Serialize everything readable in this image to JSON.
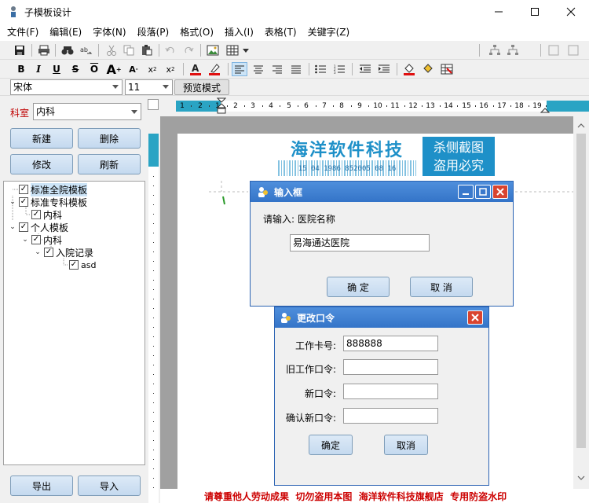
{
  "window": {
    "title": "子模板设计"
  },
  "menu": [
    "文件(F)",
    "编辑(E)",
    "字体(N)",
    "段落(P)",
    "格式(O)",
    "插入(I)",
    "表格(T)",
    "关键字(Z)"
  ],
  "format_bar": {
    "font": "宋体",
    "size": "11",
    "preview_button": "预览模式"
  },
  "left": {
    "department_label": "科室",
    "department_value": "内科",
    "new_button": "新建",
    "delete_button": "删除",
    "edit_button": "修改",
    "refresh_button": "刷新",
    "export_button": "导出",
    "import_button": "导入",
    "tree": [
      {
        "label": "标准全院模板",
        "toggle": "",
        "checked": true
      },
      {
        "label": "标准专科模板",
        "toggle": "v",
        "checked": true
      },
      {
        "label": "内科",
        "toggle": "",
        "checked": true
      },
      {
        "label": "个人模板",
        "toggle": "v",
        "checked": true
      },
      {
        "label": "内科",
        "toggle": "v",
        "checked": true
      },
      {
        "label": "入院记录",
        "toggle": "v",
        "checked": true
      },
      {
        "label": "asd",
        "toggle": "",
        "checked": true
      }
    ]
  },
  "ruler": {
    "labels": [
      "1",
      "2",
      "1",
      "2",
      "3",
      "4",
      "5",
      "6",
      "7",
      "8",
      "9",
      "10",
      "11",
      "12",
      "13",
      "14",
      "15",
      "16",
      "17",
      "18",
      "19"
    ]
  },
  "watermark": {
    "brand": "海洋软件科技",
    "digits": "15 04 1986 852005 08 16",
    "stamp_line1": "杀侧截图",
    "stamp_line2": "盗用必究",
    "footer": "请尊重他人劳动成果  切勿盗用本图  海洋软件科技旗舰店  专用防盗水印"
  },
  "input_dialog": {
    "title": "输入框",
    "prompt": "请输入: 医院名称",
    "value": "易海通达医院",
    "ok": "确 定",
    "cancel": "取 消"
  },
  "password_dialog": {
    "title": "更改口令",
    "card_label": "工作卡号:",
    "card_value": "888888",
    "old_label": "旧工作口令:",
    "new_label": "新口令:",
    "confirm_label": "确认新口令:",
    "ok": "确定",
    "cancel": "取消"
  },
  "colors": {
    "accent": "#3474c8",
    "watermark": "#1e90c8",
    "ruler_band": "#2aa4c4",
    "footer_text": "#cc0000"
  }
}
